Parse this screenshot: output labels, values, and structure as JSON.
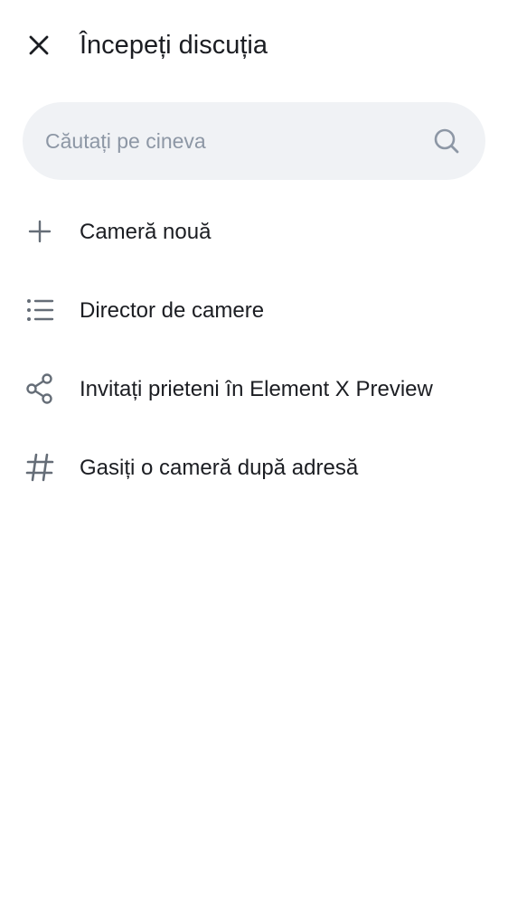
{
  "header": {
    "title": "Începeți discuția",
    "close_icon": "close-icon"
  },
  "search": {
    "placeholder": "Căutați pe cineva",
    "value": "",
    "icon": "search-icon"
  },
  "menu": {
    "items": [
      {
        "label": "Cameră nouă",
        "icon": "plus-icon"
      },
      {
        "label": "Director de camere",
        "icon": "list-icon"
      },
      {
        "label": "Invitați prieteni în Element X Preview",
        "icon": "share-icon"
      },
      {
        "label": "Gasiți o cameră după adresă",
        "icon": "hash-icon"
      }
    ]
  },
  "colors": {
    "text": "#1b1d22",
    "icon": "#656d77",
    "search_bg": "#f0f2f5",
    "placeholder": "#8d97a5"
  }
}
